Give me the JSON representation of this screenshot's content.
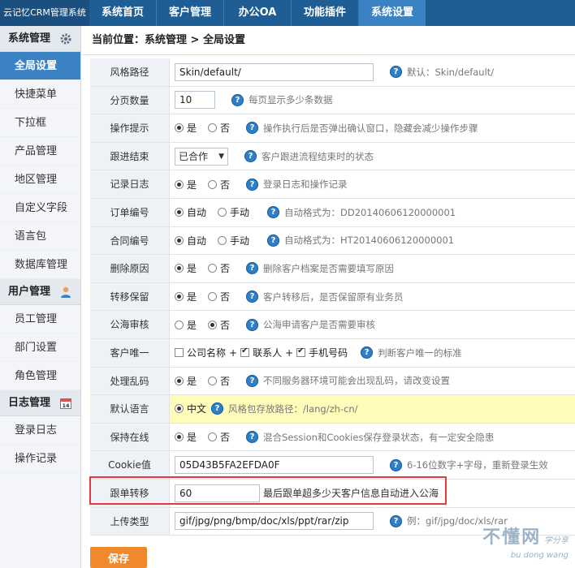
{
  "brand": "云记忆CRM管理系统",
  "nav": [
    {
      "label": "系统首页",
      "active": false
    },
    {
      "label": "客户管理",
      "active": false
    },
    {
      "label": "办公OA",
      "active": false
    },
    {
      "label": "功能插件",
      "active": false
    },
    {
      "label": "系统设置",
      "active": true
    }
  ],
  "sidebar": {
    "system": {
      "title": "系统管理",
      "items": [
        "全局设置",
        "快捷菜单",
        "下拉框",
        "产品管理",
        "地区管理",
        "自定义字段",
        "语言包",
        "数据库管理"
      ]
    },
    "user": {
      "title": "用户管理",
      "items": [
        "员工管理",
        "部门设置",
        "角色管理"
      ]
    },
    "log": {
      "title": "日志管理",
      "items": [
        "登录日志",
        "操作记录"
      ]
    }
  },
  "breadcrumb": "当前位置：系统管理 > 全局设置",
  "form": {
    "skin": {
      "label": "风格路径",
      "value": "Skin/default/",
      "help": "默认：Skin/default/"
    },
    "pagesize": {
      "label": "分页数量",
      "value": "10",
      "help": "每页显示多少条数据"
    },
    "confirm": {
      "label": "操作提示",
      "opt_yes": "是",
      "opt_no": "否",
      "help": "操作执行后是否弹出确认窗口，隐藏会减少操作步骤"
    },
    "followend": {
      "label": "跟进结束",
      "value": "已合作",
      "help": "客户跟进流程结束时的状态"
    },
    "logrecord": {
      "label": "记录日志",
      "opt_yes": "是",
      "opt_no": "否",
      "help": "登录日志和操作记录"
    },
    "orderno": {
      "label": "订单编号",
      "opt_auto": "自动",
      "opt_manual": "手动",
      "help": "自动格式为：DD20140606120000001"
    },
    "contractno": {
      "label": "合同编号",
      "opt_auto": "自动",
      "opt_manual": "手动",
      "help": "自动格式为：HT20140606120000001"
    },
    "deletereason": {
      "label": "删除原因",
      "opt_yes": "是",
      "opt_no": "否",
      "help": "删除客户档案是否需要填写原因"
    },
    "transferkeep": {
      "label": "转移保留",
      "opt_yes": "是",
      "opt_no": "否",
      "help": "客户转移后，是否保留原有业务员"
    },
    "seaaudit": {
      "label": "公海审核",
      "opt_yes": "是",
      "opt_no": "否",
      "help": "公海申请客户是否需要审核"
    },
    "unique": {
      "label": "客户唯一",
      "opt_company": "公司名称",
      "plus": "+",
      "opt_contact": "联系人",
      "opt_mobile": "手机号码",
      "help": "判断客户唯一的标准"
    },
    "garbled": {
      "label": "处理乱码",
      "opt_yes": "是",
      "opt_no": "否",
      "help": "不同服务器环境可能会出现乱码，请改变设置"
    },
    "language": {
      "label": "默认语言",
      "opt_cn": "中文",
      "help": "风格包存放路径：/lang/zh-cn/"
    },
    "keeponline": {
      "label": "保持在线",
      "opt_yes": "是",
      "opt_no": "否",
      "help": "混合Session和Cookies保存登录状态，有一定安全隐患"
    },
    "cookie": {
      "label": "Cookie值",
      "value": "05D43B5FA2EFDA0F",
      "help": "6-16位数字+字母，重新登录生效"
    },
    "followtransfer": {
      "label": "跟单转移",
      "value": "60",
      "help": "最后跟单超多少天客户信息自动进入公海"
    },
    "uploadtype": {
      "label": "上传类型",
      "value": "gif/jpg/png/bmp/doc/xls/ppt/rar/zip",
      "help": "例：gif/jpg/doc/xls/rar"
    }
  },
  "save_label": "保存",
  "watermark": {
    "main": "不懂网",
    "sub1": "学分享",
    "sub2": "bu dong wang"
  },
  "colors": {
    "topbar": "#1f5d95",
    "accent": "#3b82c4",
    "save": "#f0892b",
    "highlight": "#e23b3b",
    "yellow_row": "#fffbb8"
  }
}
